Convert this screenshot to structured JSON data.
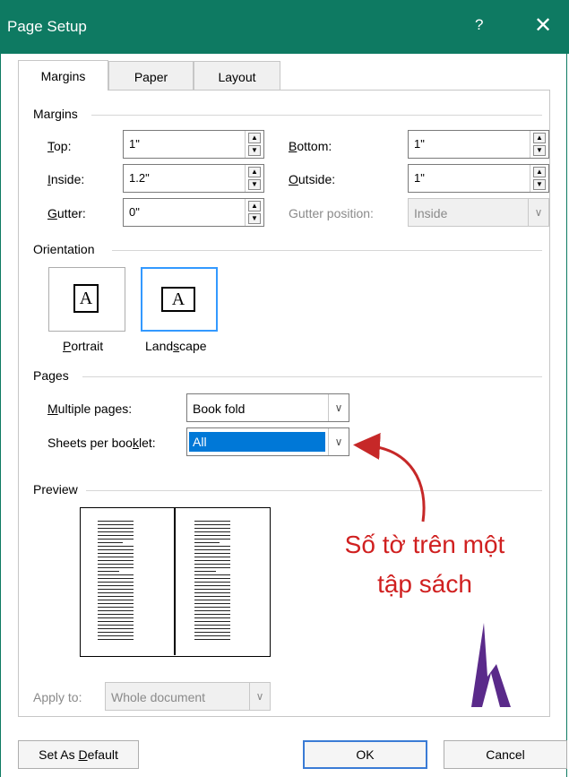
{
  "window": {
    "title": "Page Setup",
    "help": "?",
    "close": "✕"
  },
  "tabs": [
    "Margins",
    "Paper",
    "Layout"
  ],
  "margins": {
    "group_label": "Margins",
    "top": {
      "label_u": "T",
      "label_rest": "op:",
      "value": "1\""
    },
    "inside": {
      "label_u": "I",
      "label_rest": "nside:",
      "value": "1.2\""
    },
    "gutter": {
      "label_u": "G",
      "label_rest": "utter:",
      "value": "0\""
    },
    "bottom": {
      "label_u": "B",
      "label_rest": "ottom:",
      "value": "1\""
    },
    "outside": {
      "label_u": "O",
      "label_rest": "utside:",
      "value": "1\""
    },
    "gutter_position": {
      "label": "Gutter position:",
      "value": "Inside"
    }
  },
  "orientation": {
    "group_label": "Orientation",
    "portrait": {
      "glyph": "A",
      "label_u": "P",
      "label_rest": "ortrait"
    },
    "landscape": {
      "glyph": "A",
      "label_pre": "Land",
      "label_u": "s",
      "label_rest": "cape"
    }
  },
  "pages": {
    "group_label": "Pages",
    "multiple_pages": {
      "label_u": "M",
      "label_rest": "ultiple pages:",
      "value": "Book fold"
    },
    "sheets_per_booklet": {
      "label_pre": "Sheets per boo",
      "label_u": "k",
      "label_rest": "let:",
      "value": "All"
    }
  },
  "preview": {
    "group_label": "Preview"
  },
  "apply_to": {
    "label": "Apply to:",
    "value": "Whole document"
  },
  "buttons": {
    "set_default_pre": "Set As ",
    "set_default_u": "D",
    "set_default_rest": "efault",
    "ok": "OK",
    "cancel": "Cancel"
  },
  "annotation": {
    "line1": "Số tờ trên một",
    "line2": "tập sách",
    "color": "#d02020"
  },
  "logo_color": "#5a2a8a"
}
